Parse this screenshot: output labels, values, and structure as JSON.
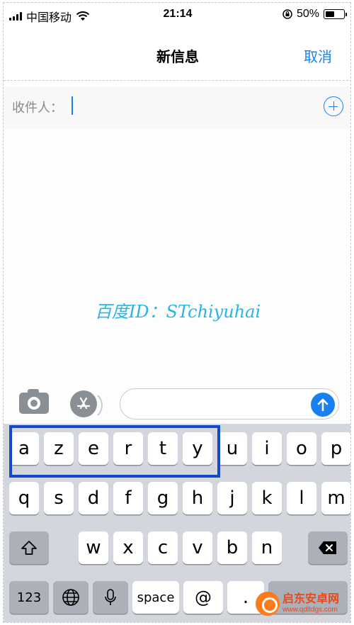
{
  "status_bar": {
    "carrier": "中国移动",
    "time": "21:14",
    "battery": "50%",
    "battery_level": 0.5
  },
  "nav": {
    "title": "新信息",
    "cancel_label": "取消"
  },
  "recipient": {
    "label": "收件人："
  },
  "watermark": "百度ID：STchiyuhai",
  "keyboard": {
    "row1": [
      "a",
      "z",
      "e",
      "r",
      "t",
      "y",
      "u",
      "i",
      "o",
      "p"
    ],
    "row2": [
      "q",
      "s",
      "d",
      "f",
      "g",
      "h",
      "j",
      "k",
      "l",
      "m"
    ],
    "row3": [
      "w",
      "x",
      "c",
      "v",
      "b",
      "n"
    ],
    "numbers_key": "123",
    "space_key": "space",
    "at_key": "@",
    "dot_key": "."
  },
  "brand": {
    "name": "启东安卓网",
    "url": "www.qdltdgs.com"
  },
  "icons": {
    "signal": "signal-bars-icon",
    "wifi": "wifi-icon",
    "rotation_lock": "rotation-lock-icon",
    "battery": "battery-icon",
    "add_contact": "plus-circle-icon",
    "camera": "camera-icon",
    "app_store": "app-store-icon",
    "send": "send-arrow-icon",
    "shift": "shift-icon",
    "backspace": "backspace-icon",
    "globe": "globe-icon",
    "microphone": "microphone-icon"
  },
  "colors": {
    "accent": "#1a7ff0",
    "highlight_box": "#1448c8",
    "watermark": "#27b5e6"
  }
}
